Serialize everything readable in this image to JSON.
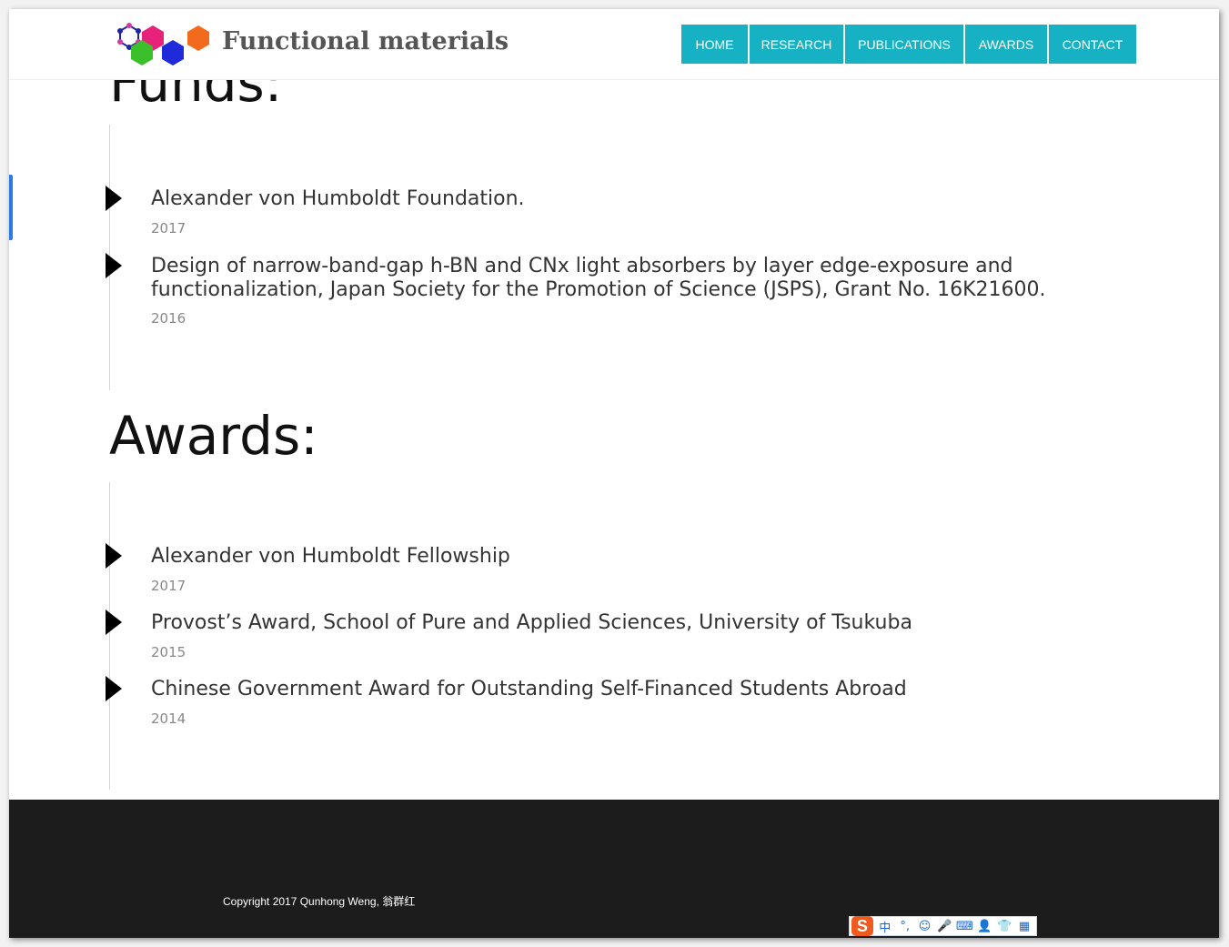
{
  "header": {
    "brand": "Functional materials",
    "nav": [
      {
        "label": "HOME"
      },
      {
        "label": "RESEARCH"
      },
      {
        "label": "PUBLICATIONS"
      },
      {
        "label": "AWARDS"
      },
      {
        "label": "CONTACT"
      }
    ]
  },
  "funds": {
    "heading": "Funds:",
    "items": [
      {
        "title": "Alexander von Humboldt Foundation.",
        "year": "2017"
      },
      {
        "title": "Design of narrow-band-gap h-BN and CNx light absorbers by layer edge-exposure and functionalization, Japan Society for the Promotion of Science (JSPS), Grant No. 16K21600.",
        "year": "2016"
      }
    ]
  },
  "awards": {
    "heading": "Awards:",
    "items": [
      {
        "title": "Alexander von Humboldt Fellowship",
        "year": "2017"
      },
      {
        "title": "Provost’s Award, School of Pure and Applied Sciences, University of Tsukuba",
        "year": "2015"
      },
      {
        "title": "Chinese Government Award for Outstanding Self-Financed Students Abroad",
        "year": "2014"
      }
    ]
  },
  "footer": {
    "copyright": "Copyright 2017 Qunhong Weng, 翁群红"
  },
  "ime_toolbar": {
    "logo": "S",
    "buttons": [
      {
        "icon": "chinese-mode-icon",
        "glyph": "中"
      },
      {
        "icon": "punctuation-icon",
        "glyph": "°,"
      },
      {
        "icon": "emoji-icon",
        "glyph": "☺"
      },
      {
        "icon": "microphone-icon",
        "glyph": "🎤"
      },
      {
        "icon": "keyboard-icon",
        "glyph": "⌨"
      },
      {
        "icon": "user-icon",
        "glyph": "👤"
      },
      {
        "icon": "skin-icon",
        "glyph": "👕"
      },
      {
        "icon": "menu-grid-icon",
        "glyph": "▦"
      }
    ]
  },
  "colors": {
    "nav_bg": "#16b2c4",
    "footer_bg": "#1c1c1c",
    "accent": "#2a7be4"
  }
}
